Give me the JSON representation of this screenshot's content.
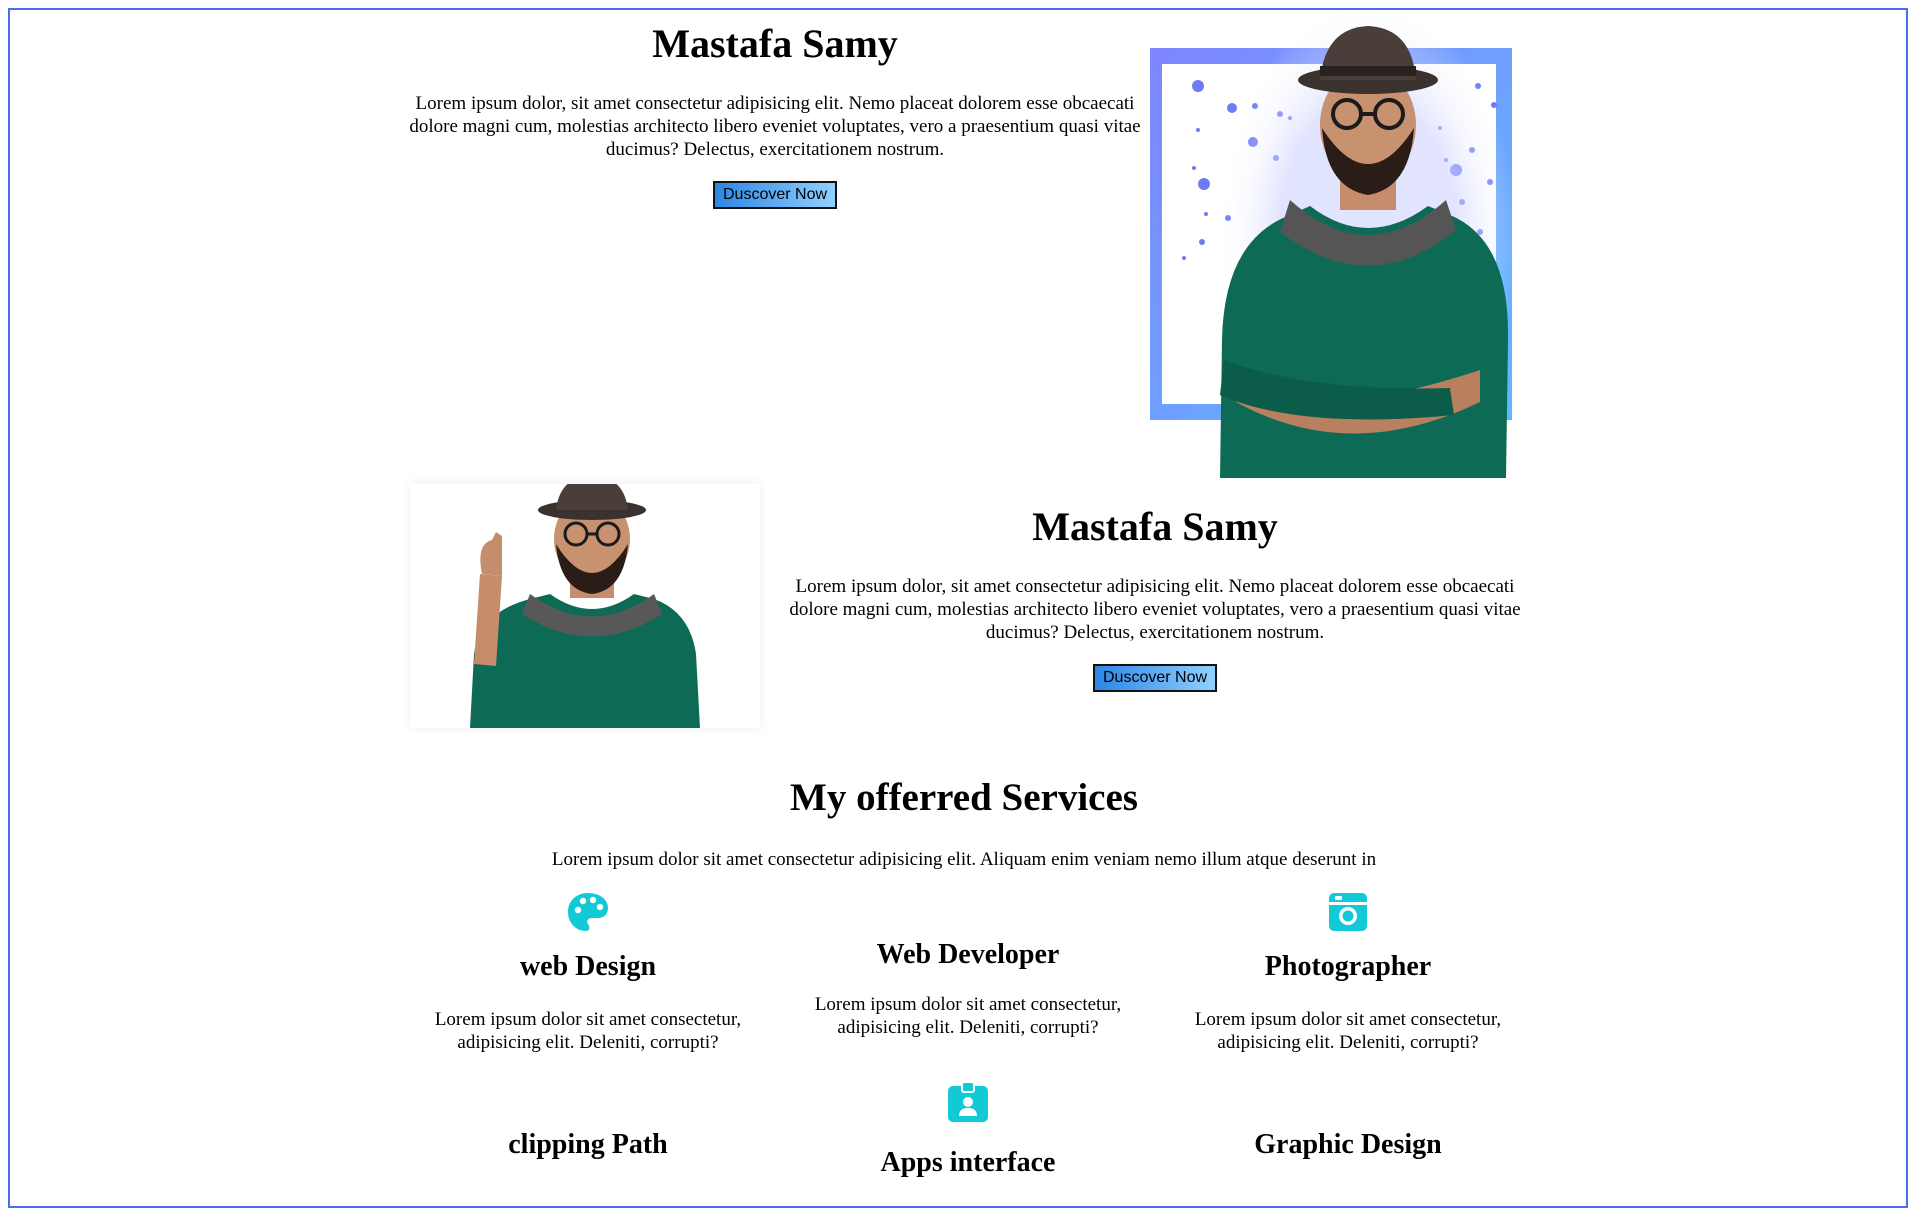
{
  "hero1": {
    "title": "Mastafa Samy",
    "description": "Lorem ipsum dolor, sit amet consectetur adipisicing elit. Nemo placeat dolorem esse obcaecati dolore magni cum, molestias architecto libero eveniet voluptates, vero a praesentium quasi vitae ducimus? Delectus, exercitationem nostrum.",
    "button_label": "Duscover Now"
  },
  "hero2": {
    "title": "Mastafa Samy",
    "description": "Lorem ipsum dolor, sit amet consectetur adipisicing elit. Nemo placeat dolorem esse obcaecati dolore magni cum, molestias architecto libero eveniet voluptates, vero a praesentium quasi vitae ducimus? Delectus, exercitationem nostrum.",
    "button_label": "Duscover Now"
  },
  "services": {
    "title": "My offerred Services",
    "subtitle": "Lorem ipsum dolor sit amet consectetur adipisicing elit. Aliquam enim veniam nemo illum atque deserunt in",
    "items": [
      {
        "title": "web Design",
        "description": "Lorem ipsum dolor sit amet consectetur, adipisicing elit. Deleniti, corrupti?",
        "icon": "palette-icon"
      },
      {
        "title": "Web Developer",
        "description": "Lorem ipsum dolor sit amet consectetur, adipisicing elit. Deleniti, corrupti?",
        "icon": ""
      },
      {
        "title": "Photographer",
        "description": "Lorem ipsum dolor sit amet consectetur, adipisicing elit. Deleniti, corrupti?",
        "icon": "camera-icon"
      },
      {
        "title": "clipping Path",
        "description": "",
        "icon": ""
      },
      {
        "title": "Apps interface",
        "description": "",
        "icon": "id-badge-icon"
      },
      {
        "title": "Graphic Design",
        "description": "",
        "icon": ""
      }
    ]
  },
  "colors": {
    "icon_accent": "#12c9d6",
    "frame_border": "#4a6cf0",
    "button_gradient_start": "#2d86e6",
    "button_gradient_end": "#8fd0ff",
    "sweater_green": "#0d6b55"
  }
}
